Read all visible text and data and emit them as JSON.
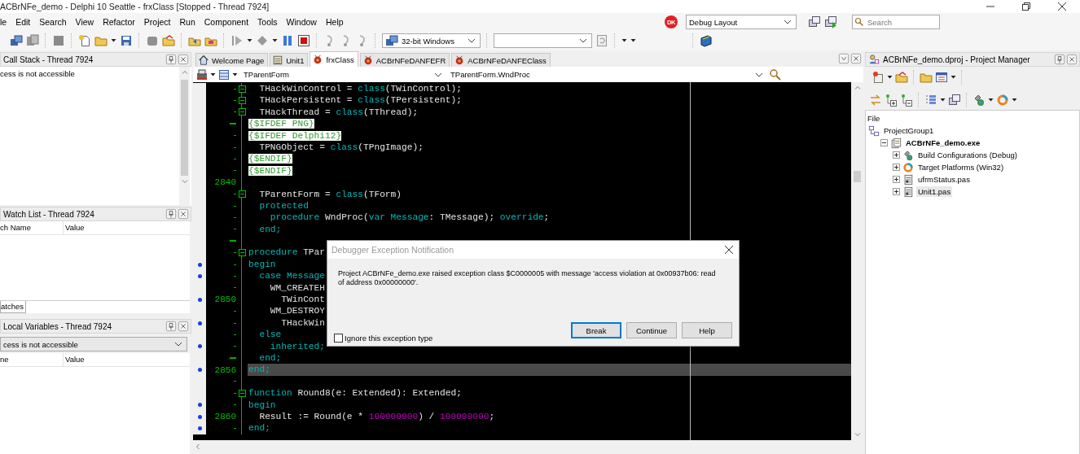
{
  "window": {
    "title": "ACBrNFe_demo - Delphi 10 Seattle - frxClass [Stopped - Thread 7924]"
  },
  "menu": [
    "le",
    "Edit",
    "Search",
    "View",
    "Refactor",
    "Project",
    "Run",
    "Component",
    "Tools",
    "Window",
    "Help"
  ],
  "status_badge": "DK",
  "layout_combo": "Debug Layout",
  "search": {
    "placeholder": "Search"
  },
  "platform_combo": "32-bit Windows",
  "call_stack": {
    "title": "Call Stack - Thread 7924",
    "rows": [
      "cess is not accessible"
    ]
  },
  "watch_list": {
    "title": "Watch List - Thread 7924",
    "columns": [
      "ch Name",
      "Value"
    ],
    "tabs": [
      {
        "label": "atches",
        "selected": true
      }
    ]
  },
  "local_variables": {
    "title": "Local Variables - Thread 7924",
    "context": "cess is not accessible",
    "columns": [
      "ne",
      "Value"
    ]
  },
  "editor": {
    "tabs": [
      {
        "label": "Welcome Page",
        "kind": "home",
        "selected": false
      },
      {
        "label": "Unit1",
        "kind": "form",
        "selected": false
      },
      {
        "label": "frxClass",
        "kind": "module",
        "selected": true
      },
      {
        "label": "ACBrNFeDANFEFR",
        "kind": "module",
        "selected": false
      },
      {
        "label": "ACBrNFeDANFEClass",
        "kind": "module",
        "selected": false
      }
    ],
    "class_combo": "TParentForm",
    "method_combo": "TParentForm.WndProc",
    "lines": [
      {
        "modified": false,
        "fold": true,
        "breakpoint": false,
        "current": false,
        "tokens": [
          {
            "kind": "plain",
            "text": "  THackWinControl = "
          },
          {
            "kind": "keyword",
            "text": "class"
          },
          {
            "kind": "plain",
            "text": "(TWinControl);"
          }
        ]
      },
      {
        "modified": false,
        "fold": true,
        "breakpoint": false,
        "current": false,
        "tokens": [
          {
            "kind": "plain",
            "text": "  THackPersistent = "
          },
          {
            "kind": "keyword",
            "text": "class"
          },
          {
            "kind": "plain",
            "text": "(TPersistent);"
          }
        ]
      },
      {
        "modified": false,
        "fold": true,
        "breakpoint": false,
        "current": false,
        "tokens": [
          {
            "kind": "plain",
            "text": "  THackThread = "
          },
          {
            "kind": "keyword",
            "text": "class"
          },
          {
            "kind": "plain",
            "text": "(TThread);"
          }
        ]
      },
      {
        "modified": true,
        "fold": false,
        "breakpoint": false,
        "current": false,
        "tokens": [
          {
            "kind": "directive",
            "text": "{$IFDEF PNG}"
          }
        ]
      },
      {
        "modified": false,
        "fold": false,
        "breakpoint": false,
        "current": false,
        "tokens": [
          {
            "kind": "directive",
            "text": "{$IFDEF Delphi12}"
          }
        ]
      },
      {
        "modified": false,
        "fold": false,
        "breakpoint": false,
        "current": false,
        "tokens": [
          {
            "kind": "plain",
            "text": "  TPNGObject = "
          },
          {
            "kind": "keyword",
            "text": "class"
          },
          {
            "kind": "plain",
            "text": "(TPngImage);"
          }
        ]
      },
      {
        "modified": false,
        "fold": false,
        "breakpoint": false,
        "current": false,
        "tokens": [
          {
            "kind": "directive",
            "text": "{$ENDIF}"
          }
        ]
      },
      {
        "modified": false,
        "fold": false,
        "breakpoint": false,
        "current": false,
        "tokens": [
          {
            "kind": "directive",
            "text": "{$ENDIF}"
          }
        ]
      },
      {
        "number": "2840",
        "fold": false,
        "breakpoint": false,
        "current": false
      },
      {
        "modified": false,
        "fold": true,
        "breakpoint": false,
        "current": false,
        "tokens": [
          {
            "kind": "plain",
            "text": "  TParentForm = "
          },
          {
            "kind": "keyword",
            "text": "class"
          },
          {
            "kind": "plain",
            "text": "(TForm)"
          }
        ]
      },
      {
        "modified": false,
        "fold": false,
        "breakpoint": false,
        "current": false,
        "tokens": [
          {
            "kind": "keyword",
            "text": "  protected"
          }
        ]
      },
      {
        "modified": false,
        "fold": false,
        "breakpoint": false,
        "current": false,
        "tokens": [
          {
            "kind": "keyword",
            "text": "    procedure"
          },
          {
            "kind": "plain",
            "text": " WndProc("
          },
          {
            "kind": "keyword",
            "text": "var Message"
          },
          {
            "kind": "plain",
            "text": ": TMessage); "
          },
          {
            "kind": "keyword",
            "text": "override"
          },
          {
            "kind": "plain",
            "text": ";"
          }
        ]
      },
      {
        "modified": false,
        "fold": false,
        "breakpoint": false,
        "current": false,
        "tokens": [
          {
            "kind": "keyword",
            "text": "  end;"
          }
        ]
      },
      {
        "modified": true,
        "fold": false,
        "breakpoint": false,
        "current": false
      },
      {
        "modified": false,
        "fold": true,
        "breakpoint": false,
        "current": false,
        "tokens": [
          {
            "kind": "keyword",
            "text": "procedure"
          },
          {
            "kind": "plain",
            "text": " TPar"
          }
        ]
      },
      {
        "modified": false,
        "fold": false,
        "breakpoint": true,
        "current": false,
        "tokens": [
          {
            "kind": "keyword",
            "text": "begin"
          }
        ]
      },
      {
        "modified": false,
        "fold": false,
        "breakpoint": true,
        "current": false,
        "tokens": [
          {
            "kind": "keyword",
            "text": "  case Message"
          }
        ]
      },
      {
        "modified": false,
        "fold": false,
        "breakpoint": false,
        "current": false,
        "tokens": [
          {
            "kind": "plain",
            "text": "    WM_CREATEH"
          }
        ]
      },
      {
        "number": "2850",
        "fold": false,
        "breakpoint": true,
        "current": false,
        "tokens": [
          {
            "kind": "plain",
            "text": "      TWinCont"
          }
        ]
      },
      {
        "modified": false,
        "fold": false,
        "breakpoint": false,
        "current": false,
        "tokens": [
          {
            "kind": "plain",
            "text": "    WM_DESTROY"
          }
        ]
      },
      {
        "modified": false,
        "fold": false,
        "breakpoint": true,
        "current": false,
        "tokens": [
          {
            "kind": "plain",
            "text": "      THackWin"
          }
        ]
      },
      {
        "modified": false,
        "fold": false,
        "breakpoint": false,
        "current": false,
        "tokens": [
          {
            "kind": "keyword",
            "text": "  else"
          }
        ]
      },
      {
        "modified": false,
        "fold": false,
        "breakpoint": true,
        "current": false,
        "tokens": [
          {
            "kind": "keyword",
            "text": "    inherited;"
          }
        ]
      },
      {
        "modified": true,
        "fold": false,
        "breakpoint": false,
        "current": false,
        "tokens": [
          {
            "kind": "keyword",
            "text": "  end;"
          }
        ]
      },
      {
        "number": "2856",
        "fold": false,
        "breakpoint": true,
        "current": true,
        "tokens": [
          {
            "kind": "keyword",
            "text": "end;"
          }
        ]
      },
      {
        "modified": false,
        "fold": false,
        "breakpoint": false,
        "current": false
      },
      {
        "modified": false,
        "fold": true,
        "breakpoint": false,
        "current": false,
        "tokens": [
          {
            "kind": "keyword",
            "text": "function"
          },
          {
            "kind": "plain",
            "text": " Round8(e: Extended): Extended;"
          }
        ]
      },
      {
        "modified": false,
        "fold": false,
        "breakpoint": true,
        "current": false,
        "tokens": [
          {
            "kind": "keyword",
            "text": "begin"
          }
        ]
      },
      {
        "number": "2860",
        "fold": false,
        "breakpoint": true,
        "current": false,
        "tokens": [
          {
            "kind": "plain",
            "text": "  Result := Round(e * "
          },
          {
            "kind": "number",
            "text": "100000000"
          },
          {
            "kind": "plain",
            "text": ") / "
          },
          {
            "kind": "number",
            "text": "100000000"
          },
          {
            "kind": "plain",
            "text": ";"
          }
        ]
      },
      {
        "modified": false,
        "fold": false,
        "breakpoint": true,
        "current": false,
        "tokens": [
          {
            "kind": "keyword",
            "text": "end;"
          }
        ]
      }
    ]
  },
  "project_manager": {
    "title": "ACBrNFe_demo.dproj - Project Manager",
    "column": "File",
    "tree": [
      {
        "label": "ProjectGroup1",
        "kind": "group",
        "active": false,
        "selected": false,
        "children": [
          {
            "label": "ACBrNFe_demo.exe",
            "kind": "project",
            "active": true,
            "selected": false,
            "expanded": true,
            "children": [
              {
                "label": "Build Configurations (Debug)",
                "kind": "build",
                "active": false,
                "selected": false,
                "expanded": false
              },
              {
                "label": "Target Platforms (Win32)",
                "kind": "platforms",
                "active": false,
                "selected": false,
                "expanded": false
              },
              {
                "label": "ufrmStatus.pas",
                "kind": "unit",
                "active": false,
                "selected": false,
                "expanded": false
              },
              {
                "label": "Unit1.pas",
                "kind": "unit",
                "active": false,
                "selected": true,
                "expanded": false
              }
            ]
          }
        ]
      }
    ]
  },
  "dialog": {
    "title": "Debugger Exception Notification",
    "message": "Project ACBrNFe_demo.exe raised exception class $C0000005 with message 'access violation at 0x00937b06: read of address 0x00000000'.",
    "ignore": {
      "label": "Ignore this exception type",
      "checked": false
    },
    "buttons": [
      {
        "label": "Break",
        "default": true
      },
      {
        "label": "Continue",
        "default": false
      },
      {
        "label": "Help",
        "default": false
      }
    ]
  }
}
